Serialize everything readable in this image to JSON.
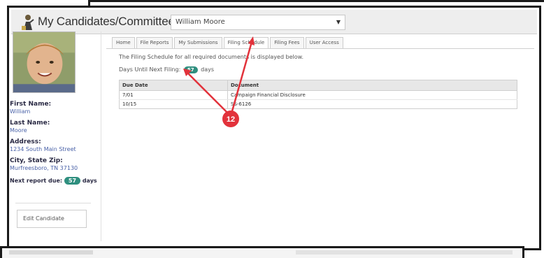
{
  "header": {
    "app_title": "My Candidates/Committees",
    "selected_candidate": "William Moore"
  },
  "sidebar": {
    "first_name_label": "First Name:",
    "first_name_value": "William",
    "last_name_label": "Last Name:",
    "last_name_value": "Moore",
    "address_label": "Address:",
    "address_value": "1234 South Main Street",
    "city_label": "City, State Zip:",
    "city_value": "Murfreesboro, TN 37130",
    "next_report_label": "Next report due:",
    "next_report_days": "57",
    "days_suffix": "days",
    "edit_button": "Edit Candidate"
  },
  "tabs": [
    {
      "label": "Home"
    },
    {
      "label": "File Reports"
    },
    {
      "label": "My Submissions"
    },
    {
      "label": "Filing Schedule"
    },
    {
      "label": "Filing Fees"
    },
    {
      "label": "User Access"
    }
  ],
  "content": {
    "intro": "The Filing Schedule for all required documents is displayed below.",
    "next_filing_prefix": "Days Until Next Filing:",
    "next_filing_days": "57",
    "next_filing_suffix": "days"
  },
  "schedule": {
    "headers": [
      "Due Date",
      "Document"
    ],
    "rows": [
      [
        "7/01",
        "Campaign Financial Disclosure"
      ],
      [
        "10/15",
        "SS-6126"
      ]
    ]
  },
  "annotation": {
    "marker_number": "12",
    "marker_color": "#e2323b"
  },
  "colors": {
    "badge": "#2f8f7f",
    "link_text": "#4a62a8",
    "header_bg": "#eeeeee"
  }
}
